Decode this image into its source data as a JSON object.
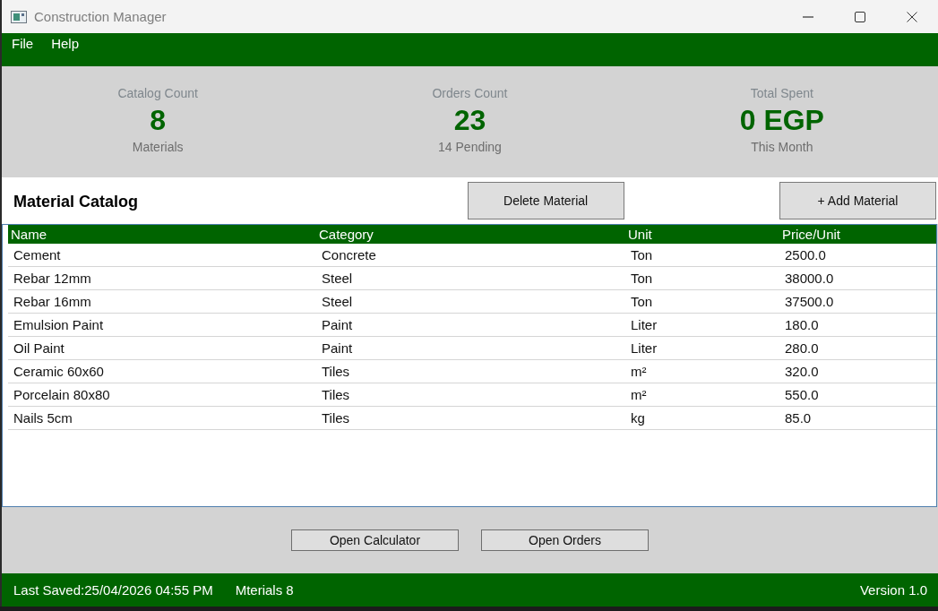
{
  "window": {
    "title": "Construction Manager"
  },
  "menu": [
    "File",
    "Help"
  ],
  "stats": [
    {
      "label": "Catalog Count",
      "value": "8",
      "caption": "Materials"
    },
    {
      "label": "Orders Count",
      "value": "23",
      "caption": "14 Pending"
    },
    {
      "label": "Total Spent",
      "value": "0 EGP",
      "caption": "This Month"
    }
  ],
  "catalog": {
    "title": "Material Catalog",
    "buttons": [
      "Delete Material",
      "+ Add Material"
    ]
  },
  "table": {
    "columns": [
      "Name",
      "Category",
      "Unit",
      "Price/Unit"
    ],
    "rows": [
      [
        "Cement",
        "Concrete",
        "Ton",
        "2500.0"
      ],
      [
        "Rebar 12mm",
        "Steel",
        "Ton",
        "38000.0"
      ],
      [
        "Rebar 16mm",
        "Steel",
        "Ton",
        "37500.0"
      ],
      [
        "Emulsion Paint",
        "Paint",
        "Liter",
        "180.0"
      ],
      [
        "Oil Paint",
        "Paint",
        "Liter",
        "280.0"
      ],
      [
        "Ceramic 60x60",
        "Tiles",
        "m²",
        "320.0"
      ],
      [
        "Porcelain 80x80",
        "Tiles",
        "m²",
        "550.0"
      ],
      [
        "Nails 5cm",
        "Tiles",
        "kg",
        "85.0"
      ]
    ]
  },
  "actions": [
    "Open Calculator",
    "Open Orders"
  ],
  "status_bar": {
    "last_saved": "Last Saved:25/04/2026 04:55 PM",
    "materials": "Mterials 8",
    "version": "Version 1.0"
  }
}
